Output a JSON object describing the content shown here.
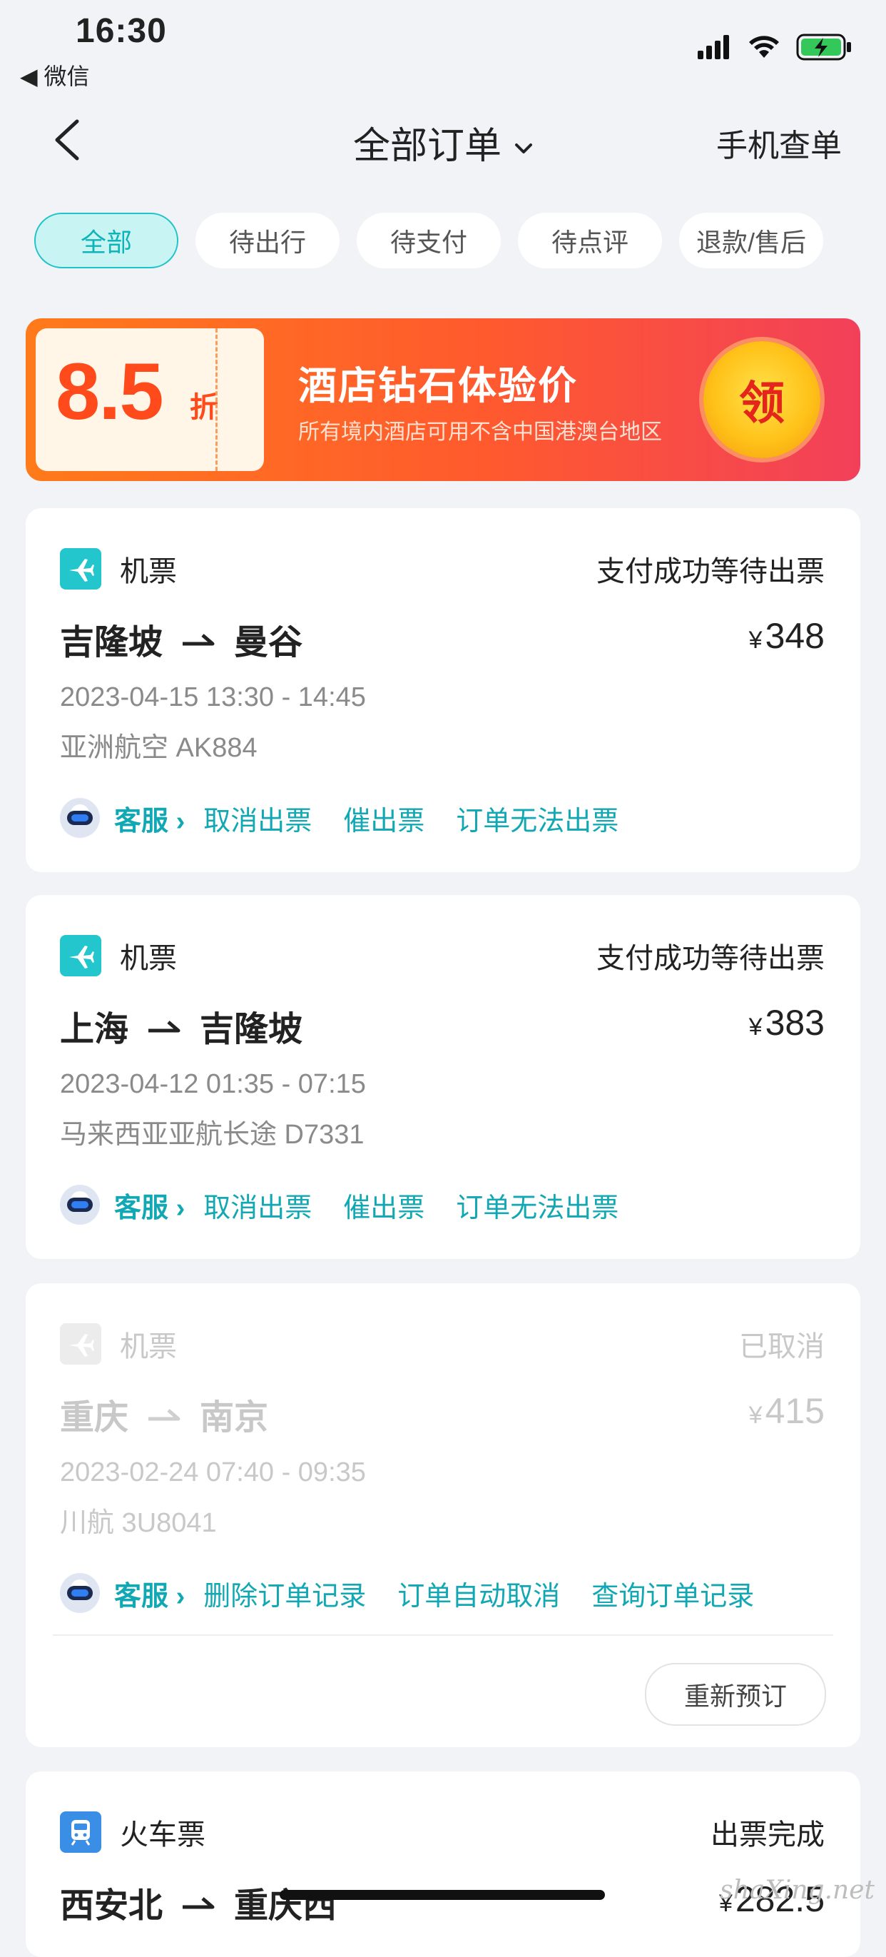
{
  "status_bar": {
    "time": "16:30",
    "back_app": "◀ 微信"
  },
  "nav": {
    "title": "全部订单",
    "right_action": "手机查单"
  },
  "tabs": [
    "全部",
    "待出行",
    "待支付",
    "待点评",
    "退款/售后"
  ],
  "banner": {
    "discount_value": "8.5",
    "discount_unit": "折",
    "title": "酒店钻石体验价",
    "subtitle": "所有境内酒店可用不含中国港澳台地区",
    "claim_button": "领"
  },
  "orders": [
    {
      "type": "机票",
      "status": "支付成功等待出票",
      "from": "吉隆坡",
      "to": "曼谷",
      "price": "348",
      "time": "2023-04-15 13:30 - 14:45",
      "flight": "亚洲航空 AK884",
      "service": "客服",
      "actions": [
        "取消出票",
        "催出票",
        "订单无法出票"
      ]
    },
    {
      "type": "机票",
      "status": "支付成功等待出票",
      "from": "上海",
      "to": "吉隆坡",
      "price": "383",
      "time": "2023-04-12 01:35 - 07:15",
      "flight": "马来西亚亚航长途 D7331",
      "service": "客服",
      "actions": [
        "取消出票",
        "催出票",
        "订单无法出票"
      ]
    },
    {
      "type": "机票",
      "status": "已取消",
      "from": "重庆",
      "to": "南京",
      "price": "415",
      "time": "2023-02-24 07:40 - 09:35",
      "flight": "川航 3U8041",
      "service": "客服",
      "actions": [
        "删除订单记录",
        "订单自动取消",
        "查询订单记录"
      ],
      "rebook": "重新预订"
    },
    {
      "type": "火车票",
      "status": "出票完成",
      "from": "西安北",
      "to": "重庆西",
      "price": "282.5"
    }
  ],
  "currency": "¥",
  "watermark": "shaXing.net",
  "colors": {
    "accent": "#1fc4c9",
    "link": "#12a8b3",
    "banner_start": "#ff7a1a",
    "banner_end": "#f2405a"
  }
}
